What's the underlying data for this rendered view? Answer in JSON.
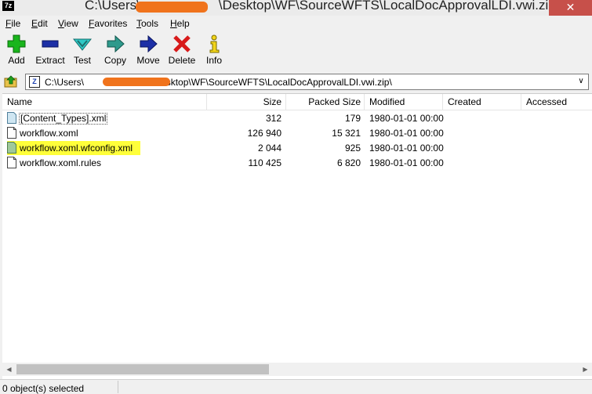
{
  "window": {
    "title": "C:\\Users\\",
    "title_rest": "\\Desktop\\WF\\SourceWFTS\\LocalDocApprovalLDI.vwi.zip\\",
    "app_icon_text": "7z",
    "close_glyph": "✕"
  },
  "menu": [
    {
      "label": "File",
      "u": "F",
      "rest": "ile"
    },
    {
      "label": "Edit",
      "u": "E",
      "rest": "dit"
    },
    {
      "label": "View",
      "u": "V",
      "rest": "iew"
    },
    {
      "label": "Favorites",
      "u": "F",
      "pre": "",
      "rest": "avorites"
    },
    {
      "label": "Tools",
      "u": "T",
      "rest": "ools"
    },
    {
      "label": "Help",
      "u": "H",
      "rest": "elp"
    }
  ],
  "toolbar": {
    "add": "Add",
    "extract": "Extract",
    "test": "Test",
    "copy": "Copy",
    "move": "Move",
    "delete": "Delete",
    "info": "Info"
  },
  "address": {
    "prefix": "C:\\Users\\",
    "suffix": "\\Desktop\\WF\\SourceWFTS\\LocalDocApprovalLDI.vwi.zip\\",
    "icon_text": "Z"
  },
  "columns": {
    "name": "Name",
    "size": "Size",
    "packed": "Packed Size",
    "modified": "Modified",
    "created": "Created",
    "accessed": "Accessed"
  },
  "files": [
    {
      "name": "[Content_Types].xml",
      "size": "312",
      "packed": "179",
      "modified": "1980-01-01 00:00",
      "icon": "xml-file-icon"
    },
    {
      "name": "workflow.xoml",
      "size": "126 940",
      "packed": "15 321",
      "modified": "1980-01-01 00:00",
      "icon": "file-icon"
    },
    {
      "name": "workflow.xoml.wfconfig.xml",
      "size": "2 044",
      "packed": "925",
      "modified": "1980-01-01 00:00",
      "icon": "xml-file-icon"
    },
    {
      "name": "workflow.xoml.rules",
      "size": "110 425",
      "packed": "6 820",
      "modified": "1980-01-01 00:00",
      "icon": "file-icon"
    }
  ],
  "status": {
    "text": "0 object(s) selected"
  },
  "colors": {
    "highlight": "#ffff3a",
    "redaction": "#f0731c",
    "close": "#c7504a"
  }
}
